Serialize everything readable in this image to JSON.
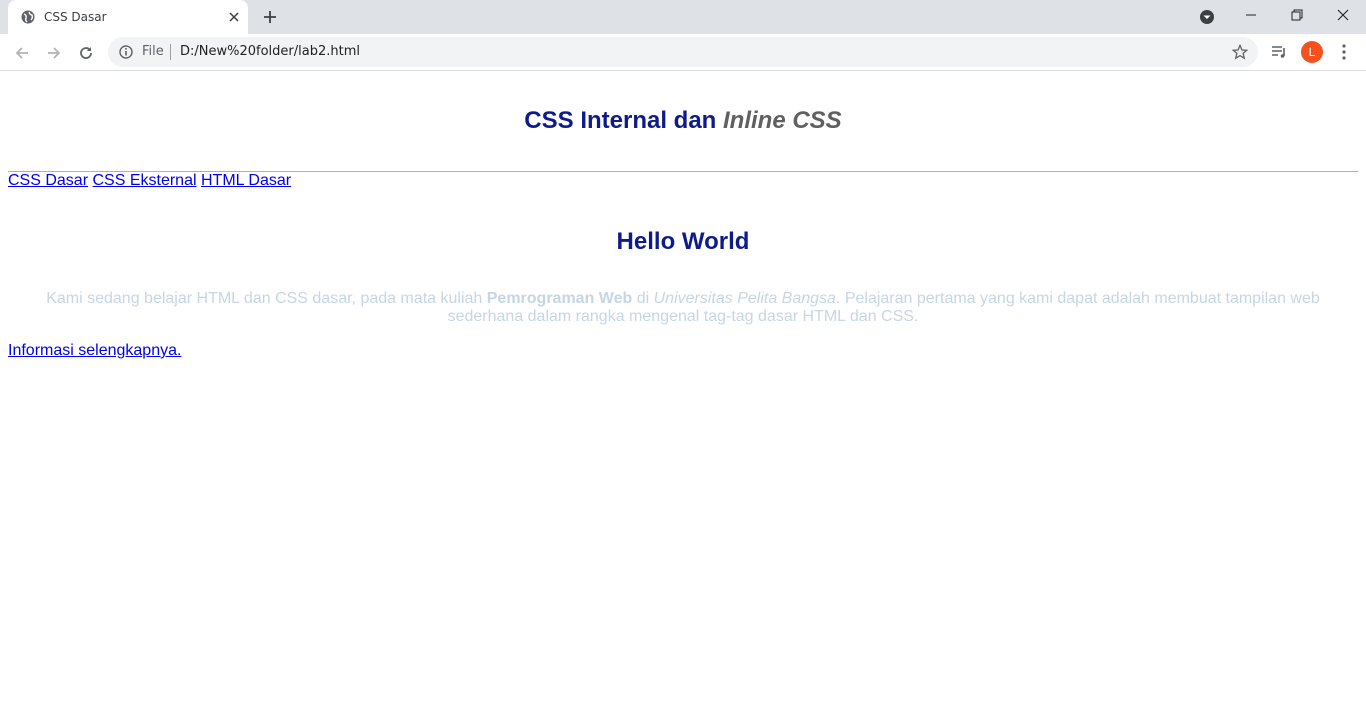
{
  "browser": {
    "tab": {
      "title": "CSS Dasar"
    },
    "omnibox": {
      "scheme_label": "File",
      "url": "D:/New%20folder/lab2.html"
    },
    "profile_initial": "L",
    "colors": {
      "tabstrip": "#dee1e6",
      "omnibox": "#f1f3f4",
      "avatar": "#f4511e"
    }
  },
  "page": {
    "title_part1": "CSS Internal dan ",
    "title_part2": "Inline",
    "title_part3": " CSS",
    "nav_links": [
      "CSS Dasar",
      "CSS Eksternal",
      "HTML Dasar"
    ],
    "heading": "Hello World",
    "paragraph": {
      "t1": "Kami sedang belajar HTML dan CSS dasar, pada mata kuliah ",
      "bold": "Pemrograman Web",
      "t2": " di ",
      "italic": "Universitas Pelita Bangsa",
      "t3": ". Pelajaran pertama yang kami dapat adalah membuat tampilan web sederhana dalam rangka mengenal tag-tag dasar HTML dan CSS."
    },
    "more_link": "Informasi selengkapnya.",
    "colors": {
      "heading": "#0f1b8a",
      "title_italic": "#606060",
      "paragraph": "#c7d6e3",
      "link": "#0000ee",
      "rule": "#7cc7cf"
    }
  }
}
